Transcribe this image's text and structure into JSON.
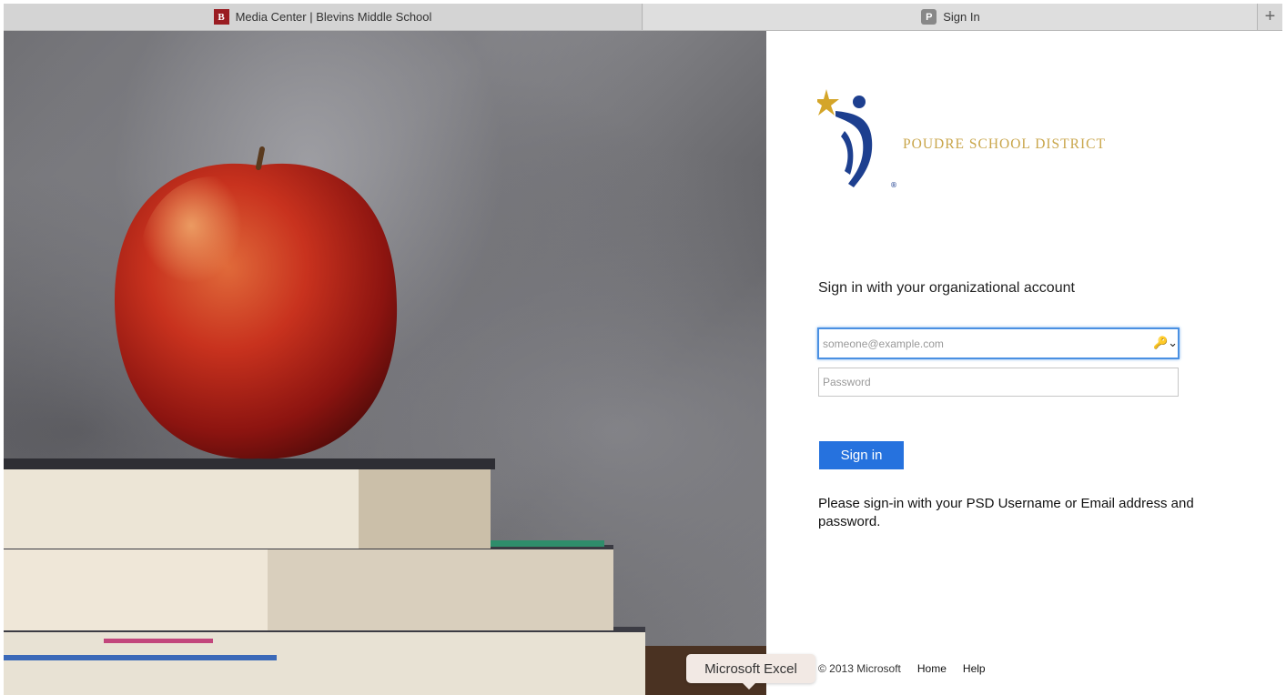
{
  "browser": {
    "tabs": [
      {
        "title": "Media Center | Blevins Middle School",
        "favicon": "B",
        "active": false
      },
      {
        "title": "Sign In",
        "favicon": "P",
        "active": true
      }
    ],
    "new_tab_label": "+"
  },
  "signin": {
    "logo_text": "POUDRE SCHOOL DISTRICT",
    "logo_trademark": "®",
    "heading": "Sign in with your organizational account",
    "email_placeholder": "someone@example.com",
    "password_placeholder": "Password",
    "key_icon": "🔑⌄",
    "button_label": "Sign in",
    "note": "Please sign-in with your PSD Username or Email address and password.",
    "footer": {
      "copyright": "© 2013 Microsoft",
      "home": "Home",
      "help": "Help"
    }
  },
  "tooltip": {
    "text": "Microsoft Excel"
  },
  "colors": {
    "accent": "#2672de",
    "logo_gold": "#c9a64b",
    "logo_blue": "#1d3f8f"
  }
}
